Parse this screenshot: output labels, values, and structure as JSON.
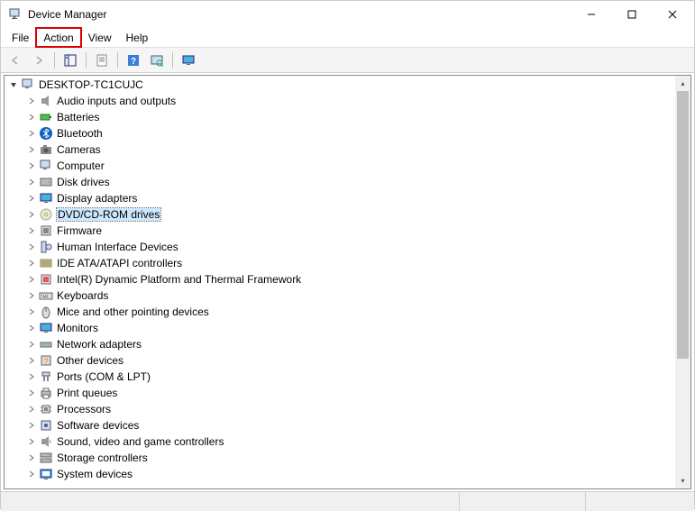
{
  "window": {
    "title": "Device Manager"
  },
  "menubar": {
    "file": "File",
    "action": "Action",
    "view": "View",
    "help": "Help"
  },
  "tree": {
    "root": "DESKTOP-TC1CUJC",
    "items": [
      {
        "label": "Audio inputs and outputs",
        "icon": "audio-icon"
      },
      {
        "label": "Batteries",
        "icon": "battery-icon"
      },
      {
        "label": "Bluetooth",
        "icon": "bluetooth-icon"
      },
      {
        "label": "Cameras",
        "icon": "camera-icon"
      },
      {
        "label": "Computer",
        "icon": "computer-icon"
      },
      {
        "label": "Disk drives",
        "icon": "disk-icon"
      },
      {
        "label": "Display adapters",
        "icon": "display-icon"
      },
      {
        "label": "DVD/CD-ROM drives",
        "icon": "dvd-icon",
        "selected": true
      },
      {
        "label": "Firmware",
        "icon": "firmware-icon"
      },
      {
        "label": "Human Interface Devices",
        "icon": "hid-icon"
      },
      {
        "label": "IDE ATA/ATAPI controllers",
        "icon": "ide-icon"
      },
      {
        "label": "Intel(R) Dynamic Platform and Thermal Framework",
        "icon": "thermal-icon"
      },
      {
        "label": "Keyboards",
        "icon": "keyboard-icon"
      },
      {
        "label": "Mice and other pointing devices",
        "icon": "mouse-icon"
      },
      {
        "label": "Monitors",
        "icon": "monitor-icon"
      },
      {
        "label": "Network adapters",
        "icon": "network-icon"
      },
      {
        "label": "Other devices",
        "icon": "other-icon"
      },
      {
        "label": "Ports (COM & LPT)",
        "icon": "ports-icon"
      },
      {
        "label": "Print queues",
        "icon": "printer-icon"
      },
      {
        "label": "Processors",
        "icon": "cpu-icon"
      },
      {
        "label": "Software devices",
        "icon": "software-icon"
      },
      {
        "label": "Sound, video and game controllers",
        "icon": "sound-icon"
      },
      {
        "label": "Storage controllers",
        "icon": "storage-icon"
      },
      {
        "label": "System devices",
        "icon": "system-icon"
      }
    ]
  }
}
